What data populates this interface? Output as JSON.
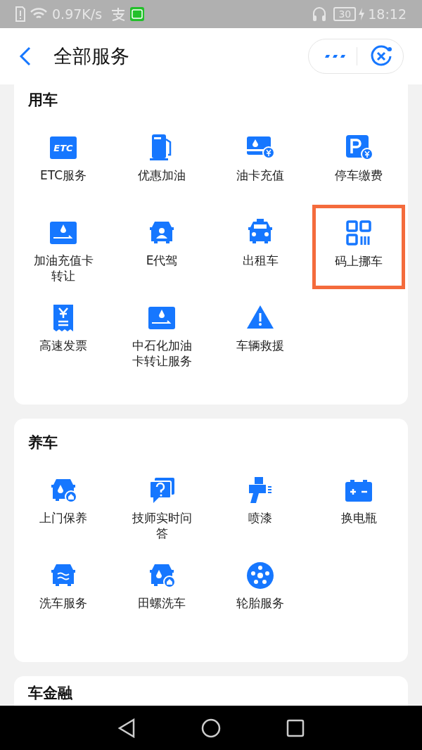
{
  "status_bar": {
    "speed": "0.97K/s",
    "battery": "30",
    "time": "18:12"
  },
  "header": {
    "title": "全部服务"
  },
  "sections": [
    {
      "title": "用车",
      "items": [
        {
          "label": "ETC服务",
          "badge": "ETC",
          "highlighted": false
        },
        {
          "label": "优惠加油",
          "highlighted": false
        },
        {
          "label": "油卡充值",
          "highlighted": false
        },
        {
          "label": "停车缴费",
          "highlighted": false
        },
        {
          "label": "加油充值卡转让",
          "highlighted": false
        },
        {
          "label": "E代驾",
          "highlighted": false
        },
        {
          "label": "出租车",
          "highlighted": false
        },
        {
          "label": "码上挪车",
          "highlighted": true
        },
        {
          "label": "高速发票",
          "highlighted": false
        },
        {
          "label": "中石化加油卡转让服务",
          "highlighted": false
        },
        {
          "label": "车辆救援",
          "highlighted": false
        }
      ]
    },
    {
      "title": "养车",
      "items": [
        {
          "label": "上门保养",
          "highlighted": false
        },
        {
          "label": "技师实时问答",
          "highlighted": false
        },
        {
          "label": "喷漆",
          "highlighted": false
        },
        {
          "label": "换电瓶",
          "highlighted": false
        },
        {
          "label": "洗车服务",
          "highlighted": false
        },
        {
          "label": "田螺洗车",
          "highlighted": false
        },
        {
          "label": "轮胎服务",
          "highlighted": false
        }
      ]
    },
    {
      "title": "车金融"
    }
  ]
}
